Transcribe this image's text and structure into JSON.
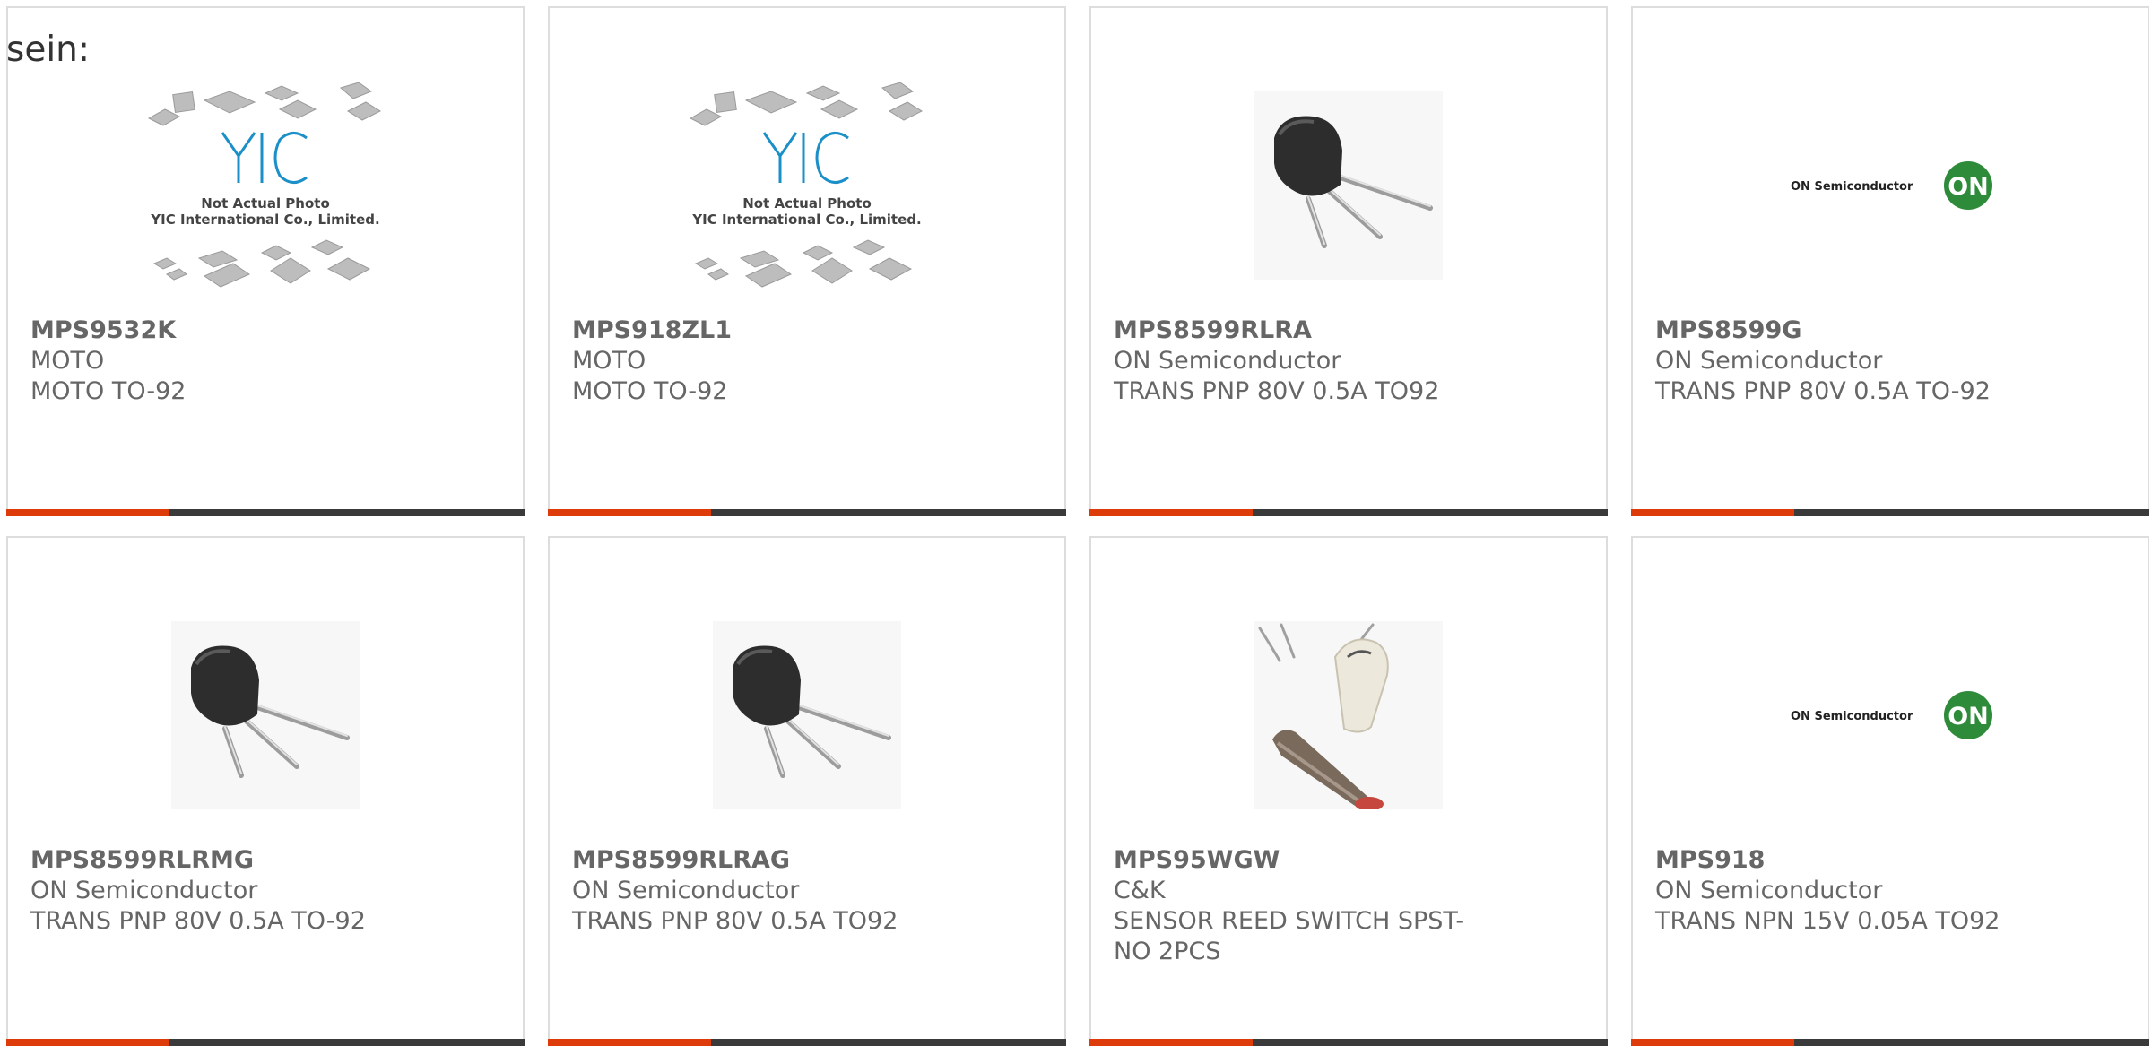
{
  "intro_text": "sein:",
  "colors": {
    "accent_red": "#dd3c0a",
    "accent_dark": "#3a3a3a",
    "card_border": "#dddddd",
    "text": "#666666",
    "on_logo_green": "#2e8b3a"
  },
  "placeholder": {
    "brand": "YIC",
    "line1": "Not Actual Photo",
    "line2": "YIC International Co., Limited."
  },
  "on_logo": {
    "wordmark": "ON Semiconductor",
    "badge": "ON"
  },
  "products": [
    {
      "part": "MPS9532K",
      "manufacturer": "MOTO",
      "description": "MOTO TO-92",
      "image": "placeholder-image"
    },
    {
      "part": "MPS918ZL1",
      "manufacturer": "MOTO",
      "description": "MOTO TO-92",
      "image": "placeholder-image"
    },
    {
      "part": "MPS8599RLRA",
      "manufacturer": "ON Semiconductor",
      "description": "TRANS PNP 80V 0.5A TO92",
      "image": "transistor-to92-image"
    },
    {
      "part": "MPS8599G",
      "manufacturer": "ON Semiconductor",
      "description": "TRANS PNP 80V 0.5A TO-92",
      "image": "on-semiconductor-logo"
    },
    {
      "part": "MPS8599RLRMG",
      "manufacturer": "ON Semiconductor",
      "description": "TRANS PNP 80V 0.5A TO-92",
      "image": "transistor-to92-image"
    },
    {
      "part": "MPS8599RLRAG",
      "manufacturer": "ON Semiconductor",
      "description": "TRANS PNP 80V 0.5A TO92",
      "image": "transistor-to92-image"
    },
    {
      "part": "MPS95WGW",
      "manufacturer": "C&K",
      "description": "SENSOR REED SWITCH SPST-NO 2PCS",
      "image": "reed-sensor-image"
    },
    {
      "part": "MPS918",
      "manufacturer": "ON Semiconductor",
      "description": "TRANS NPN 15V 0.05A TO92",
      "image": "on-semiconductor-logo"
    }
  ]
}
